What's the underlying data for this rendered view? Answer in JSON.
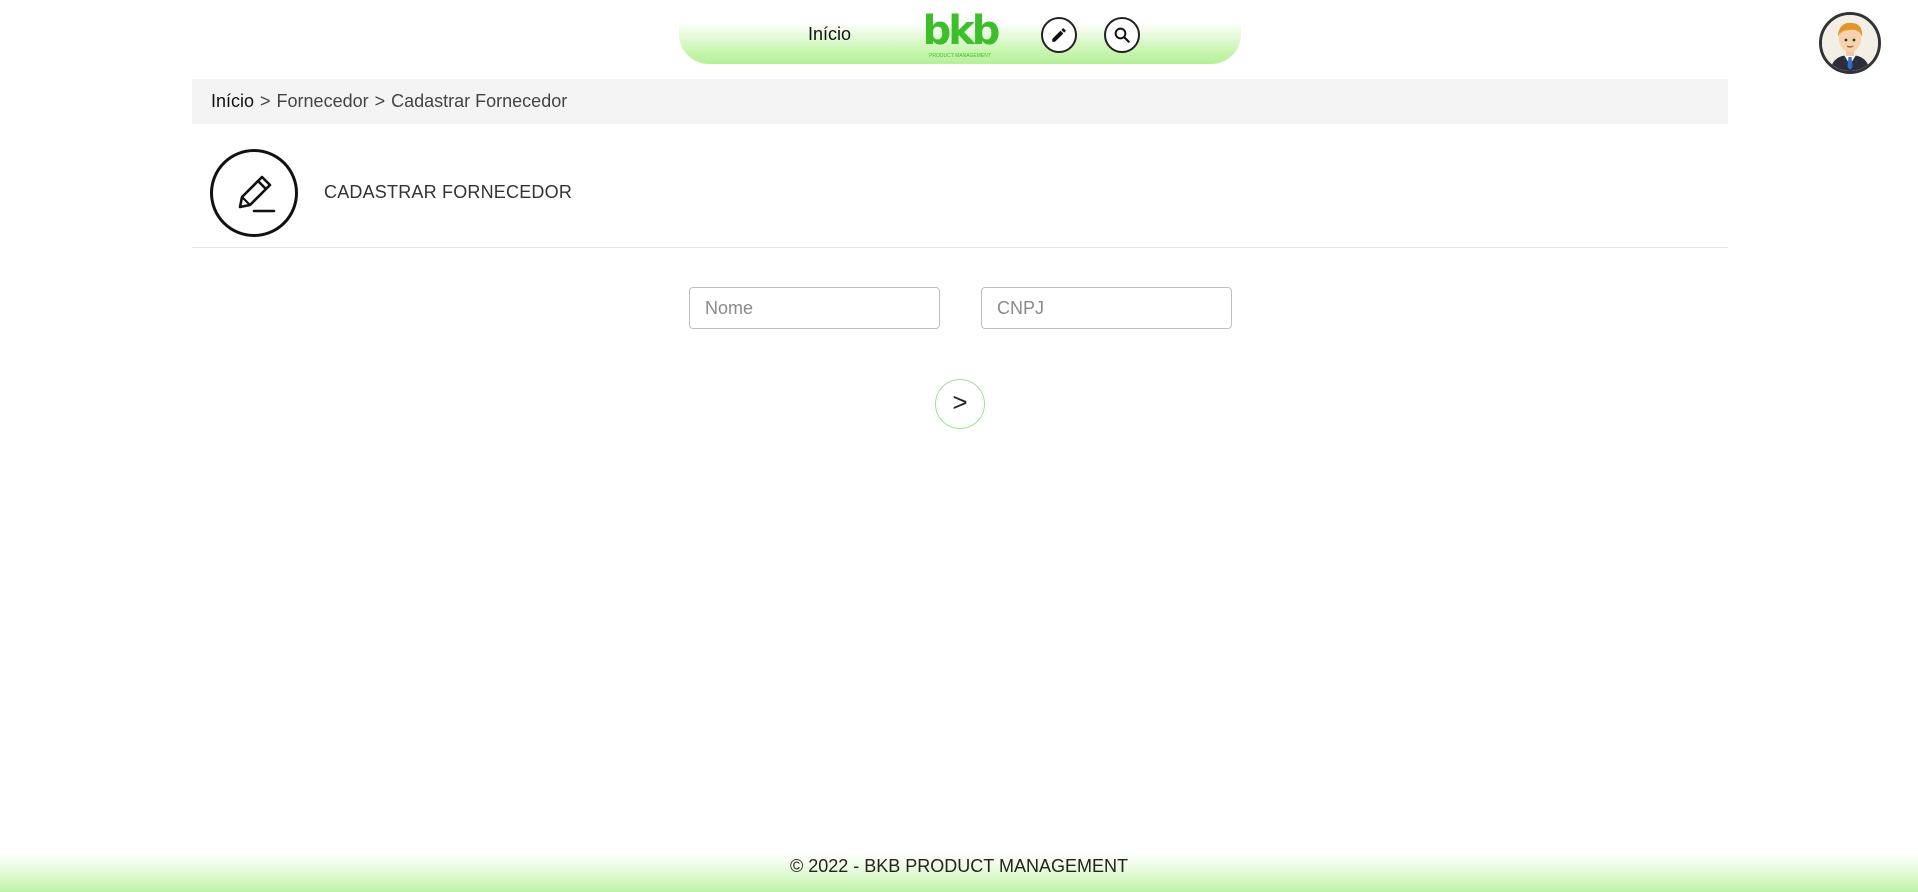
{
  "nav": {
    "home_label": "Início",
    "logo_text": "bkb",
    "logo_subtext": "PRODUCT MANAGEMENT",
    "edit_icon": "pencil-icon",
    "search_icon": "search-icon",
    "accent_color": "#3cbf2a"
  },
  "breadcrumb": {
    "home": "Início",
    "separator": ">",
    "section": "Fornecedor",
    "current": "Cadastrar Fornecedor"
  },
  "page": {
    "title": "CADASTRAR FORNECEDOR",
    "icon": "edit-icon"
  },
  "form": {
    "nome_placeholder": "Nome",
    "nome_value": "",
    "cnpj_placeholder": "CNPJ",
    "cnpj_value": "",
    "submit_label": ">"
  },
  "footer": {
    "text": "© 2022 - BKB PRODUCT MANAGEMENT"
  }
}
